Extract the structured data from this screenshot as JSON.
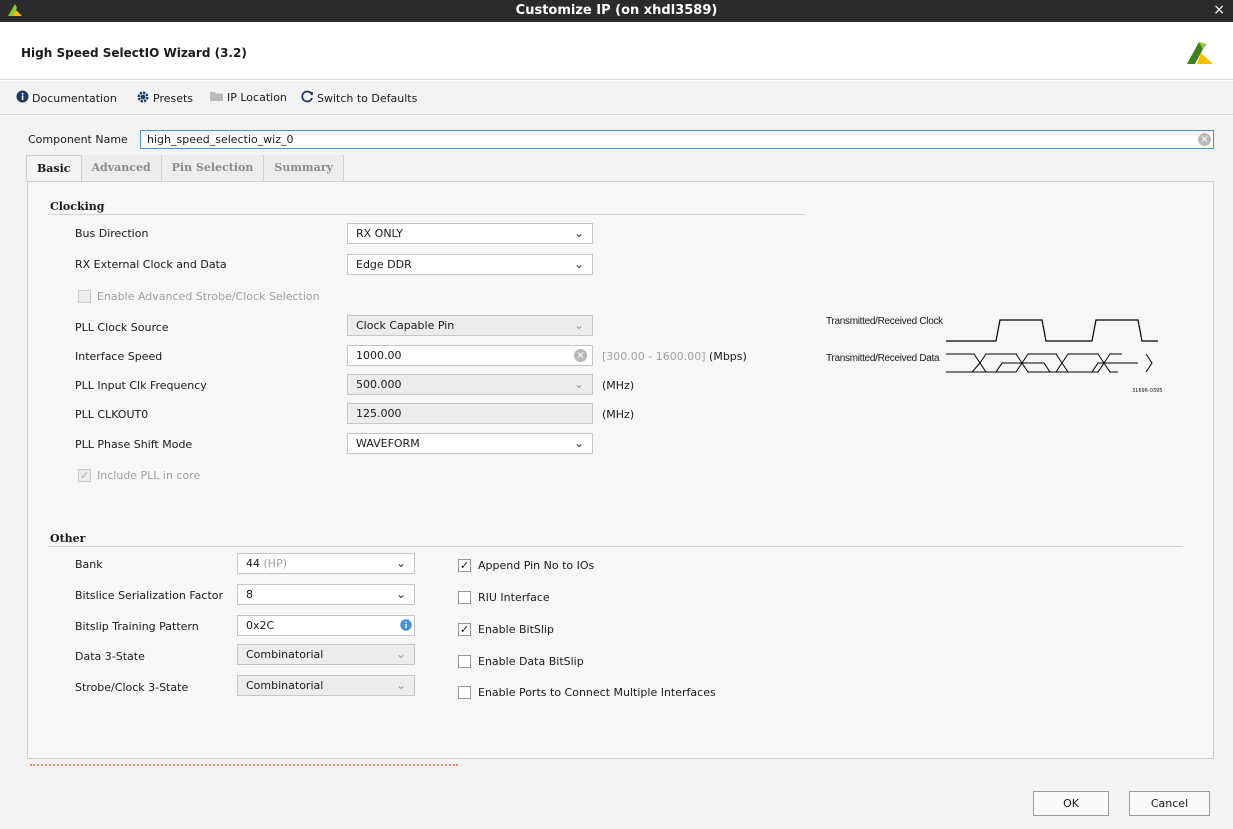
{
  "window": {
    "title": "Customize IP (on xhdl3589)",
    "close": "×"
  },
  "header": {
    "wizard_title": "High Speed SelectIO Wizard (3.2)"
  },
  "toolbar": {
    "documentation": "Documentation",
    "presets": "Presets",
    "ip_location": "IP Location",
    "switch_defaults": "Switch to Defaults"
  },
  "component": {
    "label": "Component Name",
    "value": "high_speed_selectio_wiz_0"
  },
  "tabs": [
    "Basic",
    "Advanced",
    "Pin Selection",
    "Summary"
  ],
  "clocking": {
    "title": "Clocking",
    "bus_direction": {
      "label": "Bus Direction",
      "value": "RX ONLY"
    },
    "rx_ext_clock": {
      "label": "RX External Clock and Data",
      "value": "Edge DDR"
    },
    "adv_strobe": {
      "label": "Enable Advanced Strobe/Clock Selection",
      "checked": false
    },
    "pll_clock_source": {
      "label": "PLL Clock Source",
      "value": "Clock Capable Pin"
    },
    "interface_speed": {
      "label": "Interface Speed",
      "value": "1000.00",
      "range": "[300.00 - 1600.00]",
      "unit": "(Mbps)"
    },
    "pll_input_freq": {
      "label": "PLL Input Clk Frequency",
      "value": "500.000",
      "unit": "(MHz)"
    },
    "pll_clkout0": {
      "label": "PLL CLKOUT0",
      "value": "125.000",
      "unit": "(MHz)"
    },
    "pll_phase_shift": {
      "label": "PLL Phase Shift Mode",
      "value": "WAVEFORM"
    },
    "include_pll": {
      "label": "Include PLL in core",
      "checked": true
    }
  },
  "diagram": {
    "clock_label": "Transmitted/Received Clock",
    "data_label": "Transmitted/Received Data",
    "figure_id": "31696-0395"
  },
  "other": {
    "title": "Other",
    "bank": {
      "label": "Bank",
      "value": "44",
      "suffix": "(HP)"
    },
    "bitslice_factor": {
      "label": "Bitslice Serialization Factor",
      "value": "8"
    },
    "bitslip_pattern": {
      "label": "Bitslip Training Pattern",
      "value": "0x2C"
    },
    "data_3state": {
      "label": "Data 3-State",
      "value": "Combinatorial"
    },
    "strobe_3state": {
      "label": "Strobe/Clock 3-State",
      "value": "Combinatorial"
    },
    "append_pin": {
      "label": "Append Pin No to IOs",
      "checked": true
    },
    "riu_interface": {
      "label": "RIU Interface",
      "checked": false
    },
    "enable_bitslip": {
      "label": "Enable BitSlip",
      "checked": true
    },
    "enable_data_bitslip": {
      "label": "Enable Data BitSlip",
      "checked": false
    },
    "enable_ports_multi": {
      "label": "Enable Ports to Connect Multiple Interfaces",
      "checked": false
    }
  },
  "buttons": {
    "ok": "OK",
    "cancel": "Cancel"
  },
  "colors": {
    "titlebar": "#2b2b2b",
    "focus_border": "#4a90d9",
    "logo": "#6aa91f",
    "info": "#4a90d9",
    "error": "#f08070"
  }
}
